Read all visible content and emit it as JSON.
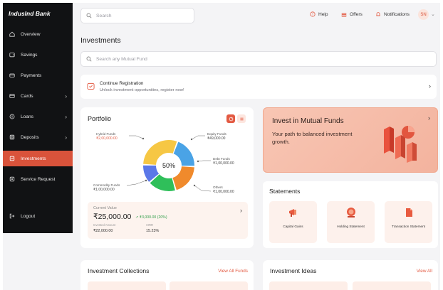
{
  "brand": "IndusInd Bank",
  "colors": {
    "accent": "#d9533b",
    "sidebar_bg": "#111214",
    "banner": "#f8c6b4",
    "positive": "#2f9e49"
  },
  "sidebar": {
    "items": [
      {
        "label": "Overview",
        "icon": "home-icon"
      },
      {
        "label": "Savings",
        "icon": "wallet-icon"
      },
      {
        "label": "Payments",
        "icon": "card-icon"
      },
      {
        "label": "Cards",
        "icon": "card-icon"
      },
      {
        "label": "Loans",
        "icon": "loan-icon"
      },
      {
        "label": "Deposits",
        "icon": "deposit-icon"
      },
      {
        "label": "Investments",
        "icon": "chart-icon",
        "active": true
      },
      {
        "label": "Service Request",
        "icon": "service-icon"
      }
    ],
    "logout": "Logout"
  },
  "header": {
    "search_placeholder": "Search",
    "help": "Help",
    "offers": "Offers",
    "notifications": "Notifications",
    "avatar": "SN"
  },
  "page": {
    "title": "Investments",
    "mf_search_placeholder": "Search any Mutual Fund"
  },
  "registration": {
    "title": "Continue Registration",
    "subtitle": "Unlock investment opportunities, register now!"
  },
  "portfolio": {
    "title": "Portfolio",
    "center": "50%",
    "labels": {
      "hybrid": {
        "name": "Hybrid Funds",
        "value": "₹2,00,000.00"
      },
      "equity": {
        "name": "Equity Funds",
        "value": "₹49,000.00"
      },
      "debt": {
        "name": "Debt Funds",
        "value": "₹1,00,000.00"
      },
      "commodity": {
        "name": "Commodity Funds",
        "value": "₹1,00,000.00"
      },
      "others": {
        "name": "Others",
        "value": "₹1,00,000.00"
      }
    },
    "current_value_label": "Current Value",
    "current_value": "₹25,000.00",
    "change": "↗ ₹3,000.00 (20%)",
    "invested_label": "Invested Amount",
    "invested": "₹22,000.00",
    "xirr_label": "XIRR",
    "xirr": "15.23%"
  },
  "chart_data": {
    "type": "pie",
    "categories": [
      "Equity Funds",
      "Debt Funds",
      "Others",
      "Commodity Funds",
      "Hybrid Funds"
    ],
    "values": [
      20,
      20,
      18,
      12,
      30
    ],
    "center_label": "50%"
  },
  "banner": {
    "title": "Invest in Mutual Funds",
    "subtitle": "Your path to balanced investment growth."
  },
  "statements": {
    "title": "Statements",
    "tiles": [
      {
        "label": "Capital Gains",
        "icon": "megaphone-icon"
      },
      {
        "label": "Holding Statement",
        "icon": "coin-icon"
      },
      {
        "label": "Transaction Statement",
        "icon": "document-icon"
      }
    ]
  },
  "collections": {
    "title": "Investment Collections",
    "view_all": "View All Funds"
  },
  "ideas": {
    "title": "Investment Ideas",
    "view_all": "View All"
  }
}
